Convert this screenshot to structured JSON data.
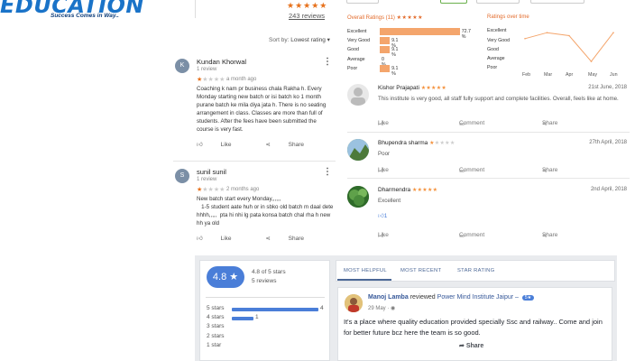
{
  "logo": {
    "word": "EDUCATION",
    "tagline": "Success Comes in Way.."
  },
  "top": {
    "stars": "★★★★★",
    "review_count": "243 reviews",
    "sort_label": "Sort by:",
    "sort_value": "Lowest rating ▾"
  },
  "reviews": [
    {
      "initial": "K",
      "name": "Kundan Khorwal",
      "count": "1 review",
      "stars": "★",
      "stars_empty": "★★★★",
      "time": "a month ago",
      "text": "Coaching k nam pr business chala Rakha h. Every Monday starting new batch or isi batch ko 1 month purane batch ke mila diya jata h. There is no seating arrangement in class. Classes are more than full of students. After the fees have been submitted  the course is very fast.",
      "like": "Like",
      "share": "Share"
    },
    {
      "initial": "S",
      "name": "sunil sunil",
      "count": "1 review",
      "stars": "★",
      "stars_empty": "★★★★",
      "time": "2 months ago",
      "text": "New batch start every Monday,,,,,,\n   1-5 student aate huh or in sbko old batch m daal dete hhhh,,,,,  pta hi nhi lg pata konsa batch chal rha h new hh ya old",
      "like": "Like",
      "share": "Share"
    }
  ],
  "overall": {
    "title": "Overall Ratings (11)",
    "stars": "★★★★★",
    "rows": [
      {
        "label": "Excellent",
        "pct": "72.7 %",
        "value": 72.7
      },
      {
        "label": "Very Good",
        "pct": "9.1 %",
        "value": 9.1
      },
      {
        "label": "Good",
        "pct": "9.1 %",
        "value": 9.1
      },
      {
        "label": "Average",
        "pct": "0 %",
        "value": 0
      },
      {
        "label": "Poor",
        "pct": "9.1 %",
        "value": 9.1
      }
    ]
  },
  "over_time": {
    "title": "Ratings over time",
    "levels": [
      "Excellent",
      "Very Good",
      "Good",
      "Average",
      "Poor"
    ],
    "months": [
      "Feb",
      "Mar",
      "Apr",
      "May",
      "Jun"
    ]
  },
  "chart_data": {
    "type": "line",
    "title": "Ratings over time",
    "x": [
      "Feb",
      "Mar",
      "Apr",
      "May",
      "Jun"
    ],
    "y_categories": [
      "Poor",
      "Average",
      "Good",
      "Very Good",
      "Excellent"
    ],
    "values": [
      4.2,
      4.8,
      4.5,
      1.9,
      4.8
    ]
  },
  "comments": [
    {
      "name": "Kishor Prajapati",
      "stars": "★★★★★",
      "stars_empty": "",
      "date": "21st June, 2018",
      "text": "This institute is very good, all staff fully support and complete facilities. Overall, feels like at home.",
      "like": "Like",
      "comment": "Comment",
      "share": "Share",
      "likes_count": ""
    },
    {
      "name": "Bhupendra sharma",
      "stars": "★",
      "stars_empty": "★★★★",
      "date": "27th April, 2018",
      "text": "Poor",
      "like": "Like",
      "comment": "Comment",
      "share": "Share",
      "likes_count": ""
    },
    {
      "name": "Dharmendra",
      "stars": "★★★★★",
      "stars_empty": "",
      "date": "2nd April, 2018",
      "text": "Excellent",
      "like": "Like",
      "comment": "Comment",
      "share": "Share",
      "likes_count": "1"
    }
  ],
  "summary": {
    "score": "4.8 ★",
    "out_of": "4.8 of 5 stars",
    "reviews": "5 reviews",
    "rows": [
      {
        "label": "5 stars",
        "count": "4",
        "value": 4
      },
      {
        "label": "4 stars",
        "count": "1",
        "value": 1
      },
      {
        "label": "3 stars",
        "count": "",
        "value": 0
      },
      {
        "label": "2 stars",
        "count": "",
        "value": 0
      },
      {
        "label": "1 star",
        "count": "",
        "value": 0
      }
    ]
  },
  "tabs": [
    "MOST HELPFUL",
    "MOST RECENT",
    "STAR RATING"
  ],
  "fb_post": {
    "author": "Manoj Lamba",
    "verb": "reviewed",
    "page": "Power Mind Institute Jaipur –",
    "badge": "5★",
    "date": "29 May · ◉",
    "text": "It's a place where quality education provided specially Ssc and railway.. Come and join for better future bcz here the team is so good.",
    "share": "Share"
  },
  "colors": {
    "accent": "#e36b2b",
    "bar": "#f4a56c",
    "blue": "#4a7ed8",
    "fb": "#365899"
  }
}
